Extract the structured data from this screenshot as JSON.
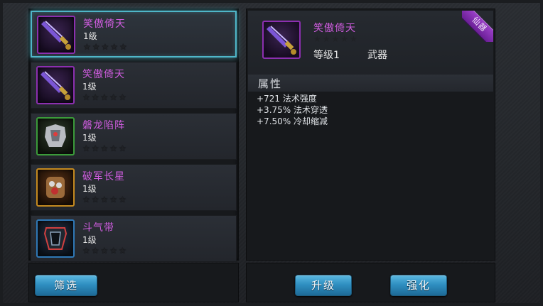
{
  "items": [
    {
      "name": "笑傲倚天",
      "level": "1级",
      "stars": "★★★★★",
      "icon": "purple-sword-icon"
    },
    {
      "name": "笑傲倚天",
      "level": "1级",
      "stars": "★★★★★",
      "icon": "purple-sword-icon"
    },
    {
      "name": "磐龙陷阵",
      "level": "1级",
      "stars": "★★★★★",
      "icon": "armor-icon"
    },
    {
      "name": "破军长星",
      "level": "1级",
      "stars": "★★★★★",
      "icon": "gauntlet-icon"
    },
    {
      "name": "斗气带",
      "level": "1级",
      "stars": "★★★★★",
      "icon": "belt-icon"
    }
  ],
  "filter_label": "筛选",
  "detail": {
    "name": "笑傲倚天",
    "stars": "★★★★★",
    "level": "等级1",
    "type": "武器",
    "badge": "仙器",
    "attr_title": "属性",
    "attrs": [
      "+721 法术强度",
      "+3.75% 法术穿透",
      "+7.50% 冷却缩减"
    ]
  },
  "upgrade_label": "升级",
  "enhance_label": "强化",
  "colors": {
    "item_name": "#d05de0",
    "button": "#2f8fc1",
    "selected_border": "#4fb6c8"
  }
}
